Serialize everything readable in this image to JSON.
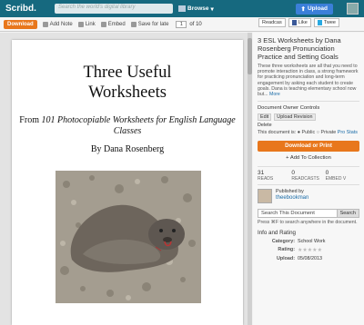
{
  "topbar": {
    "logo": "Scribd.",
    "search_placeholder": "Search the world's digital library",
    "browse_label": "Browse",
    "upload_label": "Upload"
  },
  "toolbar": {
    "download_label": "Download",
    "add_note_label": "Add Note",
    "link_label": "Link",
    "embed_label": "Embed",
    "save_label": "Save for late",
    "page_current": "1",
    "page_total_label": "of 10",
    "readcast_label": "Readcas",
    "like_label": "Like",
    "tweet_label": "Twee"
  },
  "document": {
    "title_line1": "Three Useful",
    "title_line2": "Worksheets",
    "subtitle_prefix": "From ",
    "subtitle_italic": "101 Photocopiable Worksheets for English Language Classes",
    "author_line": "By Dana Rosenberg"
  },
  "sidebar": {
    "title": "3 ESL Worksheets by Dana Rosenberg Pronunciation Practice and Setting Goals",
    "description": "These three worksheets are all that you need to promote interaction in class, a strong framework for practicing pronunciation and long-term engagement by asking each student to create goals. Dana is teaching elementary school now but...",
    "more_label": "More",
    "owner_controls_head": "Document Owner Controls",
    "edit_label": "Edit",
    "upload_revision_label": "Upload Revision",
    "delete_label": "Delete",
    "doc_is_label": "This document is:",
    "public_label": "Public",
    "private_label": "Private",
    "pro_stats_label": "Pro Stats",
    "download_print_label": "Download or Print",
    "add_collection_label": "Add To Collection",
    "stats": [
      {
        "value": "31",
        "label": "READS"
      },
      {
        "value": "0",
        "label": "READCASTS"
      },
      {
        "value": "0",
        "label": "EMBED V"
      }
    ],
    "published_by": "Published by",
    "publisher": "theebookman",
    "search_placeholder": "Search This Document",
    "search_button": "Search",
    "search_hint": "Press ⌘F to search anywhere in the document.",
    "info_head": "Info and Rating",
    "category_key": "Category:",
    "category_value": "School Work",
    "rating_key": "Rating:",
    "upload_key": "Upload:",
    "upload_value": "05/08/2013"
  }
}
